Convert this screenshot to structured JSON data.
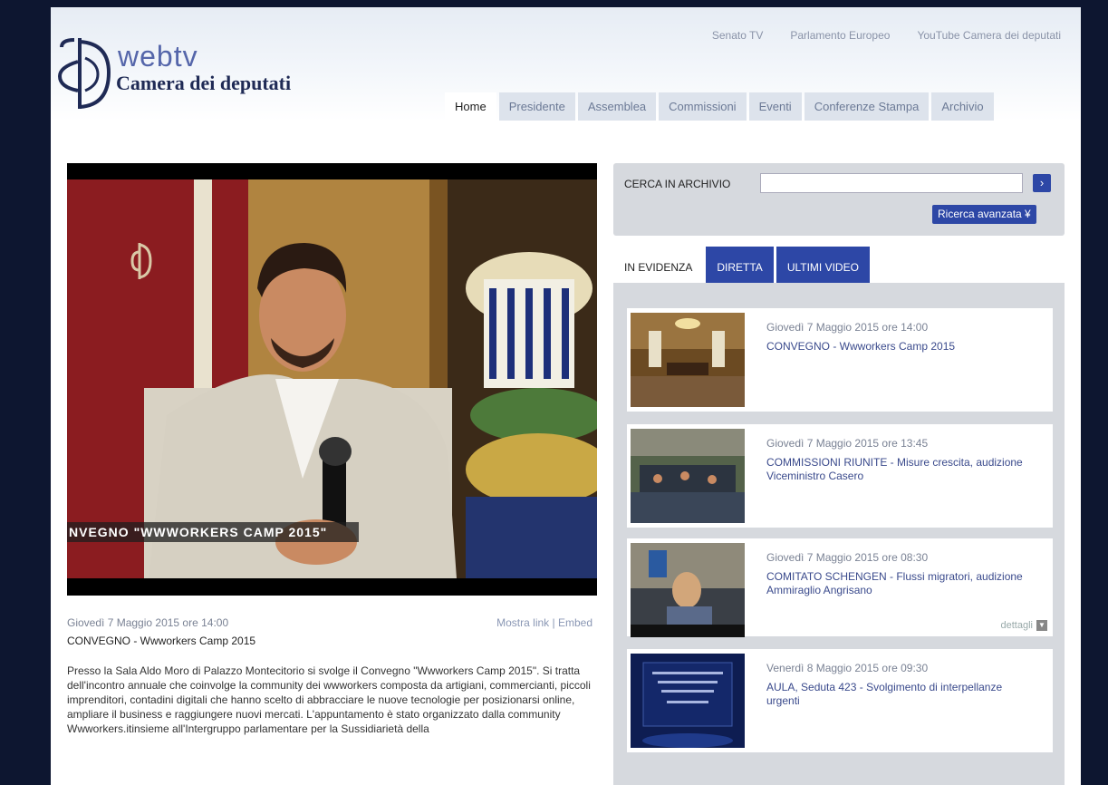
{
  "header": {
    "logo_top": "webtv",
    "logo_bottom": "Camera dei deputati",
    "top_links": [
      "Senato TV",
      "Parlamento Europeo",
      "YouTube Camera dei deputati"
    ],
    "nav": [
      "Home",
      "Presidente",
      "Assemblea",
      "Commissioni",
      "Eventi",
      "Conferenze Stampa",
      "Archivio"
    ],
    "nav_active": "Home"
  },
  "player": {
    "overlay_caption": "NVEGNO \"WWWORKERS CAMP 2015\""
  },
  "info": {
    "date": "Giovedì 7 Maggio 2015 ore 14:00",
    "links": {
      "show_link": "Mostra link",
      "separator": "|",
      "embed": "Embed"
    },
    "title": "CONVEGNO - Wwworkers Camp 2015",
    "description": "Presso la Sala Aldo Moro di Palazzo Montecitorio si svolge il Convegno \"Wwworkers Camp 2015\". Si tratta dell'incontro annuale che coinvolge la community dei wwworkers composta da artigiani, commercianti, piccoli imprenditori, contadini digitali che hanno scelto di abbracciare le nuove tecnologie per posizionarsi online, ampliare il business e raggiungere nuovi mercati. L'appuntamento è stato organizzato dalla community Wwworkers.itinsieme all'Intergruppo parlamentare per la Sussidiarietà della"
  },
  "search": {
    "label": "CERCA IN ARCHIVIO",
    "value": "",
    "go_icon": "›",
    "advanced": "Ricerca avanzata ¥"
  },
  "tabs": [
    "IN EVIDENZA",
    "DIRETTA",
    "ULTIMI VIDEO"
  ],
  "items": [
    {
      "date": "Giovedì 7 Maggio 2015 ore 14:00",
      "title": "CONVEGNO - Wwworkers Camp 2015",
      "thumb": "ornate-hall"
    },
    {
      "date": "Giovedì 7 Maggio 2015 ore 13:45",
      "title": "COMMISSIONI RIUNITE - Misure crescita, audizione Viceministro Casero",
      "thumb": "committee-room"
    },
    {
      "date": "Giovedì 7 Maggio 2015 ore 08:30",
      "title": "COMITATO SCHENGEN - Flussi migratori, audizione Ammiraglio Angrisano",
      "thumb": "speaker-desk",
      "details": "dettagli"
    },
    {
      "date": "Venerdì 8 Maggio 2015 ore 09:30",
      "title": "AULA, Seduta 423 - Svolgimento di interpellanze urgenti",
      "thumb": "aula-blue-card"
    }
  ],
  "colors": {
    "accent": "#2d47a6",
    "frame": "#0d1630",
    "panel": "#d6d9de"
  }
}
